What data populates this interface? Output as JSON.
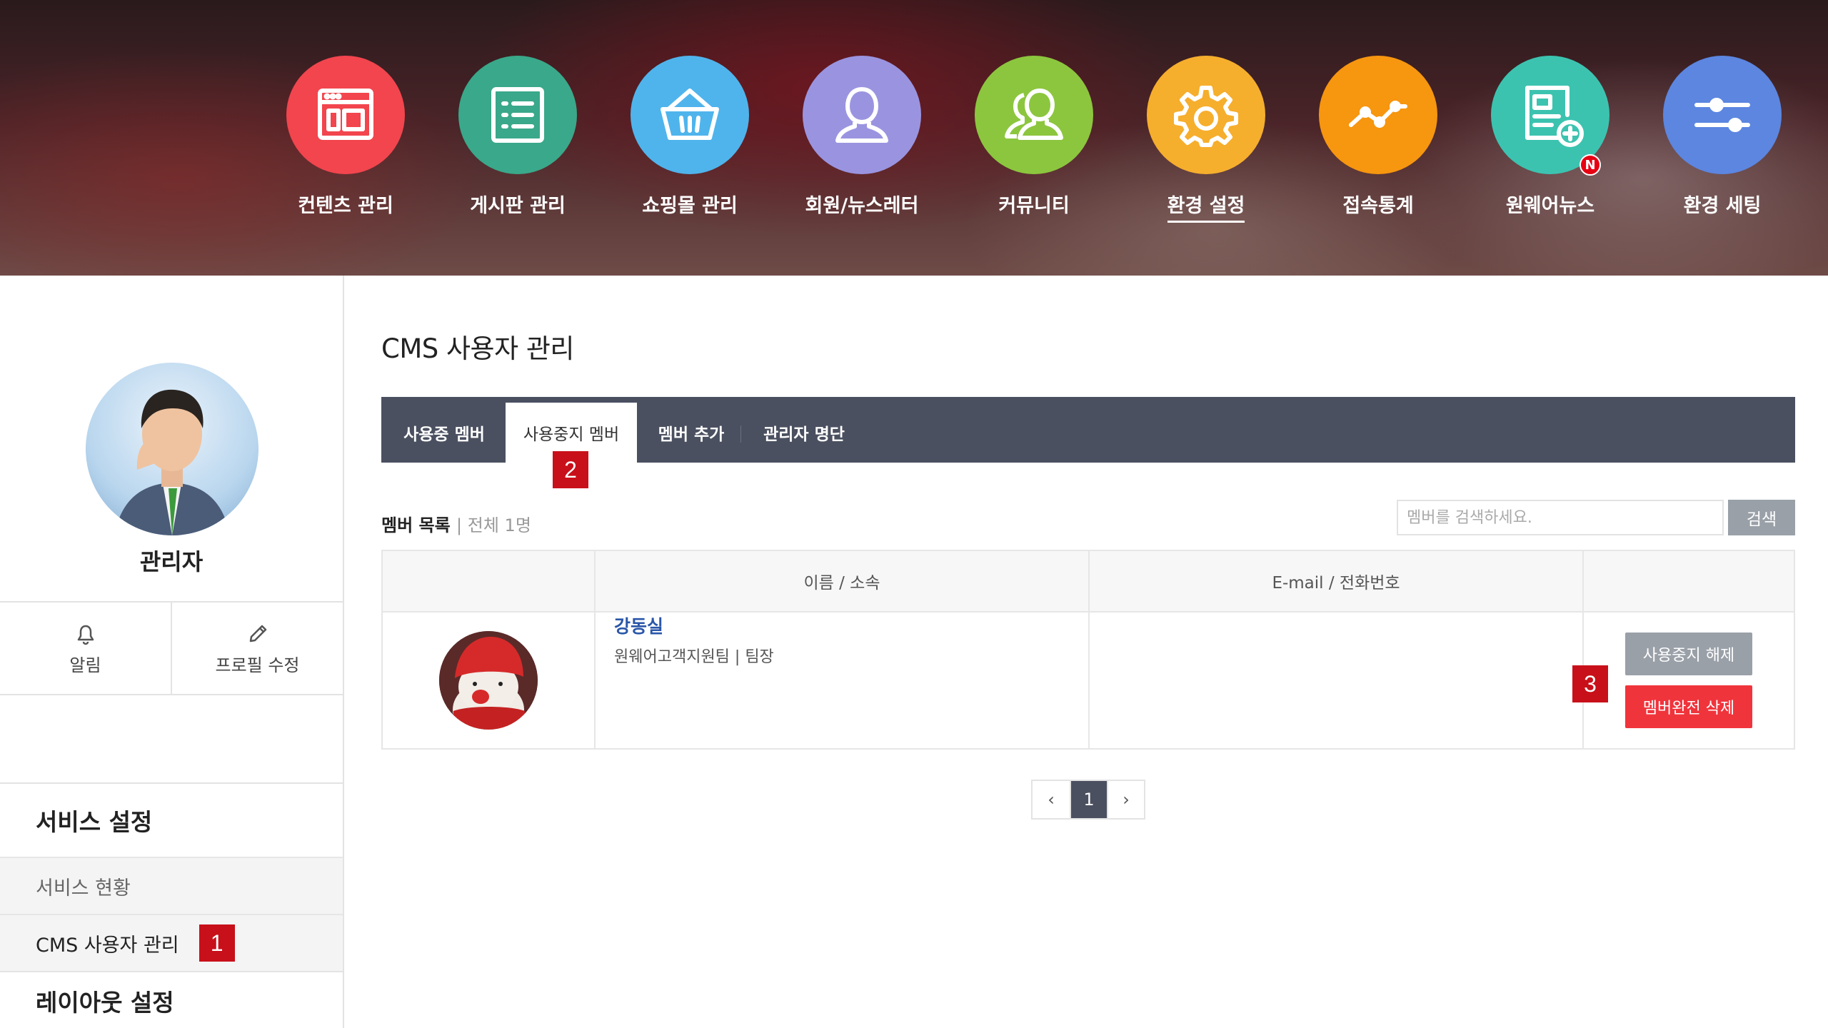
{
  "top_nav": [
    {
      "label": "컨텐츠 관리",
      "icon": "layout-icon",
      "color": "#f2454e"
    },
    {
      "label": "게시판 관리",
      "icon": "list-board-icon",
      "color": "#3aa88a"
    },
    {
      "label": "쇼핑몰 관리",
      "icon": "basket-icon",
      "color": "#4fb4ec"
    },
    {
      "label": "회원/뉴스레터",
      "icon": "user-icon",
      "color": "#9a94e0"
    },
    {
      "label": "커뮤니티",
      "icon": "users-icon",
      "color": "#8cc63e"
    },
    {
      "label": "환경 설정",
      "icon": "gear-icon",
      "color": "#f6ae2d",
      "active": true
    },
    {
      "label": "접속통계",
      "icon": "line-chart-icon",
      "color": "#f7960f"
    },
    {
      "label": "원웨어뉴스",
      "icon": "news-add-icon",
      "color": "#3cc3b0",
      "badge": "N"
    },
    {
      "label": "환경 세팅",
      "icon": "sliders-icon",
      "color": "#5c86e0"
    }
  ],
  "sidebar": {
    "profile_name": "관리자",
    "quick": [
      {
        "label": "알림",
        "icon": "bell-icon"
      },
      {
        "label": "프로필 수정",
        "icon": "pencil-icon"
      }
    ],
    "service_heading": "서비스 설정",
    "items": [
      {
        "label": "서비스 현황"
      },
      {
        "label": "CMS 사용자 관리",
        "marker": "1"
      }
    ],
    "layout_heading": "레이아웃 설정"
  },
  "main": {
    "title": "CMS 사용자 관리",
    "tabs": [
      {
        "label": "사용중 멤버"
      },
      {
        "label": "사용중지 멤버",
        "active": true,
        "marker": "2"
      },
      {
        "label": "멤버 추가"
      },
      {
        "label": "관리자 명단"
      }
    ],
    "list_label": "멤버 목록",
    "list_count": "| 전체 1명",
    "search": {
      "placeholder": "멤버를 검색하세요.",
      "button": "검색"
    },
    "table": {
      "headers": [
        "",
        "이름 / 소속",
        "E-mail / 전화번호",
        ""
      ],
      "rows": [
        {
          "name": "강동실",
          "dept": "원웨어고객지원팀 | 팀장",
          "contact": "",
          "actions": {
            "unsuspend": "사용중지 해제",
            "delete": "멤버완전 삭제"
          },
          "marker": "3"
        }
      ]
    },
    "pagination": {
      "prev": "‹",
      "current": "1",
      "next": "›"
    }
  },
  "colors": {
    "tabbar": "#4a5060",
    "marker": "#c8101a",
    "delete": "#f0343c",
    "neutral_button": "#9aa0a8"
  }
}
